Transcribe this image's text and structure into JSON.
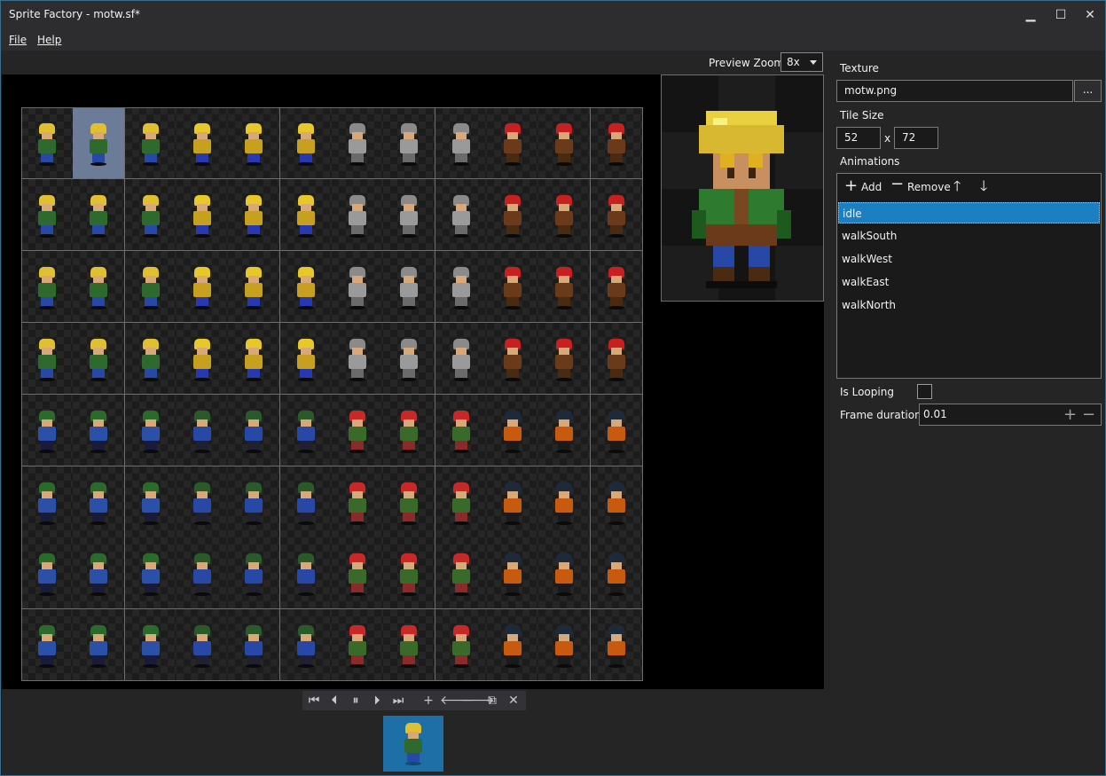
{
  "window": {
    "title": "Sprite Factory - motw.sf*",
    "minimize": "▁",
    "maximize": "☐",
    "close": "✕"
  },
  "menu": {
    "file": "File",
    "help": "Help"
  },
  "toolbar": {
    "preview_zoom_label": "Preview Zoom",
    "preview_zoom_value": "8x"
  },
  "sheet": {
    "columns": 12,
    "rows": 8,
    "selected_cell": [
      0,
      1
    ]
  },
  "playback": {
    "first": "⏮",
    "prev": "⏴",
    "pause": "⏸",
    "next": "⏵",
    "last": "⏭",
    "add": "+",
    "move_left": "🡐",
    "move_right": "🡒",
    "copy": "⧉",
    "delete": "✕"
  },
  "panel": {
    "texture_label": "Texture",
    "texture_value": "motw.png",
    "browse_label": "...",
    "tile_size_label": "Tile Size",
    "tile_width": "52",
    "tile_x": "x",
    "tile_height": "72",
    "animations_label": "Animations",
    "add_label": "Add",
    "remove_label": "Remove",
    "animations": [
      "idle",
      "walkSouth",
      "walkWest",
      "walkEast",
      "walkNorth"
    ],
    "selected_animation": "idle",
    "is_looping_label": "Is Looping",
    "is_looping": false,
    "frame_duration_label": "Frame duration",
    "frame_duration": "0.01"
  },
  "colors": {
    "selection": "#1c7fc2",
    "frame_bg": "#1d6fa5",
    "selected_cell": "#6c7b98"
  }
}
